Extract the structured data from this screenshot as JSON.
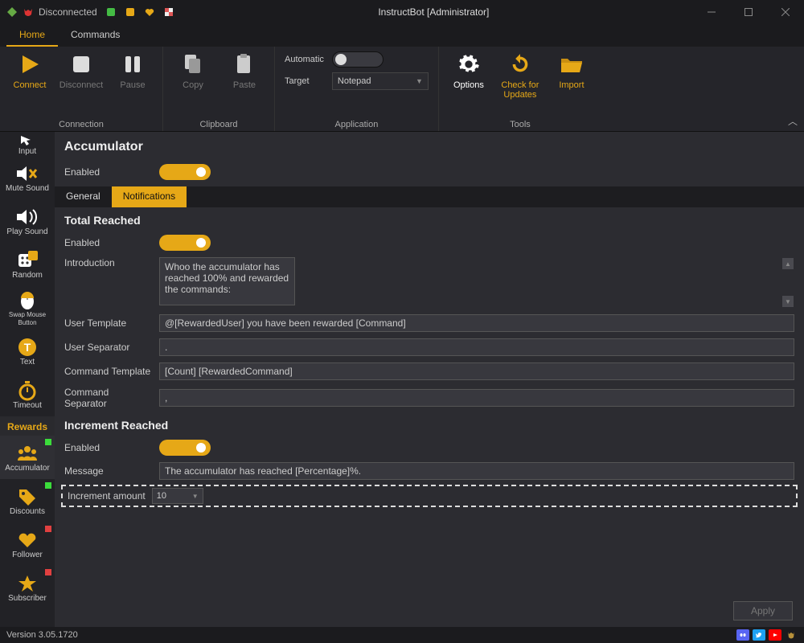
{
  "window": {
    "title": "InstructBot [Administrator]",
    "connection_status": "Disconnected"
  },
  "menu": {
    "tabs": [
      "Home",
      "Commands"
    ],
    "active": 0
  },
  "ribbon": {
    "connection": {
      "label": "Connection",
      "connect": "Connect",
      "disconnect": "Disconnect",
      "pause": "Pause"
    },
    "clipboard": {
      "label": "Clipboard",
      "copy": "Copy",
      "paste": "Paste"
    },
    "application": {
      "label": "Application",
      "automatic": "Automatic",
      "target": "Target",
      "target_value": "Notepad"
    },
    "tools": {
      "label": "Tools",
      "options": "Options",
      "check": "Check for Updates",
      "import": "Import"
    }
  },
  "sidebar": {
    "header": "Rewards",
    "items_top": [
      {
        "label": "Input"
      },
      {
        "label": "Mute Sound"
      },
      {
        "label": "Play Sound"
      },
      {
        "label": "Random"
      },
      {
        "label": "Swap Mouse Button"
      },
      {
        "label": "Text"
      },
      {
        "label": "Timeout"
      }
    ],
    "items_btm": [
      {
        "label": "Accumulator",
        "badge": "g",
        "active": true
      },
      {
        "label": "Discounts",
        "badge": "g"
      },
      {
        "label": "Follower",
        "badge": "r"
      },
      {
        "label": "Subscriber",
        "badge": "r"
      }
    ]
  },
  "main": {
    "title": "Accumulator",
    "enabled_label": "Enabled",
    "subtabs": [
      "General",
      "Notifications"
    ],
    "subtab_active": 1,
    "total": {
      "title": "Total Reached",
      "enabled_label": "Enabled",
      "introduction_label": "Introduction",
      "introduction": "Whoo the accumulator has reached 100% and rewarded the commands:",
      "user_template_label": "User Template",
      "user_template": "@[RewardedUser] you have been rewarded [Command]",
      "user_separator_label": "User Separator",
      "user_separator": ".",
      "command_template_label": "Command Template",
      "command_template": "[Count] [RewardedCommand]",
      "command_separator_label": "Command Separator",
      "command_separator": ","
    },
    "increment": {
      "title": "Increment Reached",
      "enabled_label": "Enabled",
      "message_label": "Message",
      "message": "The accumulator has reached [Percentage]%.",
      "amount_label": "Increment amount",
      "amount_value": "10"
    },
    "apply": "Apply"
  },
  "statusbar": {
    "version": "Version 3.05.1720"
  }
}
